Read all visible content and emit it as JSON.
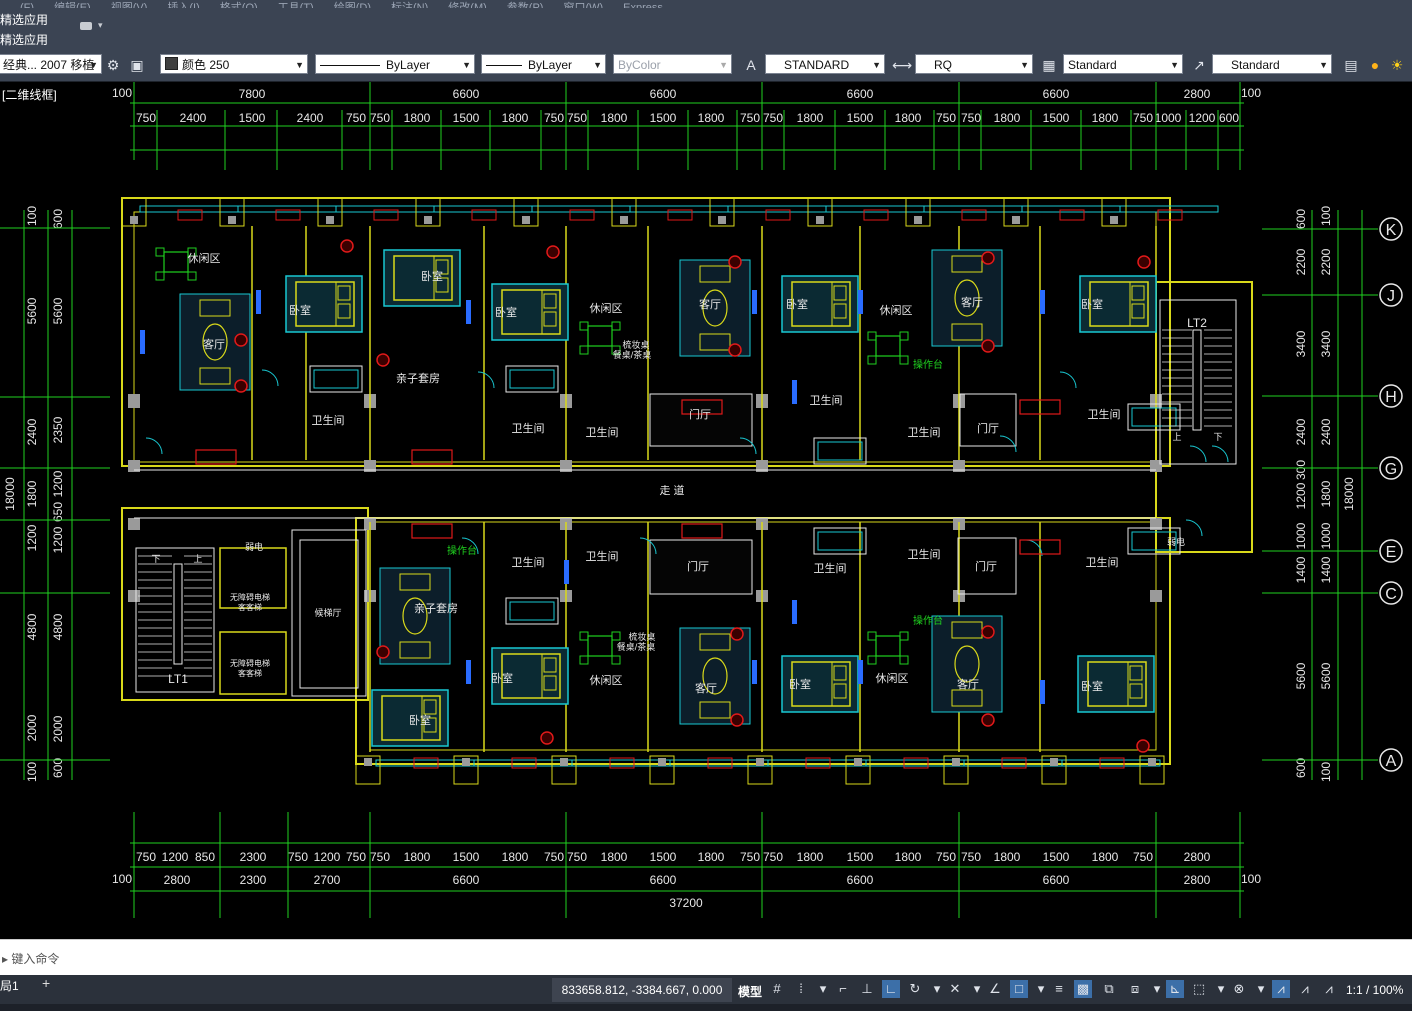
{
  "menubar": {
    "items": [
      "(F)",
      "编辑(E)",
      "视图(V)",
      "插入(I)",
      "格式(O)",
      "工具(T)",
      "绘图(D)",
      "标注(N)",
      "修改(M)",
      "参数(P)",
      "窗口(W)",
      "Express"
    ]
  },
  "ribbon": {
    "tab_label": "精选应用",
    "panel_label": "精选应用"
  },
  "propbar": {
    "workspace": "经典... 2007 移植",
    "color": "颜色 250",
    "linetype": "ByLayer",
    "lineweight": "ByLayer",
    "plotstyle": "ByColor",
    "textstyle": "STANDARD",
    "dimstyle": "RQ",
    "tablestyle": "Standard",
    "mleaderstyle": "Standard"
  },
  "viewport": {
    "label": "[二维线框]"
  },
  "drawing": {
    "top_totals": [
      "7800",
      "6600",
      "6600",
      "6600",
      "6600",
      "2800"
    ],
    "top_subdims": [
      "750",
      "2400",
      "1500",
      "2400",
      "750",
      "750",
      "1800",
      "1500",
      "1800",
      "750",
      "750",
      "1800",
      "1500",
      "1800",
      "750",
      "750",
      "1800",
      "1500",
      "1800",
      "750",
      "750",
      "1800",
      "1500",
      "1800",
      "750",
      "1000",
      "1200",
      "600"
    ],
    "edge_100": "100",
    "bottom_subdims": [
      "750",
      "1200",
      "850",
      "2300",
      "750",
      "1200",
      "750",
      "750",
      "1800",
      "1500",
      "1800",
      "750",
      "750",
      "1800",
      "1500",
      "1800",
      "750",
      "750",
      "1800",
      "1500",
      "1800",
      "750",
      "750",
      "1800",
      "1500",
      "1800",
      "750",
      "2800"
    ],
    "bottom_totals": [
      "2800",
      "2300",
      "2700",
      "6600",
      "6600",
      "6600",
      "6600",
      "2800"
    ],
    "overall": "37200",
    "left_dims_outer": [
      "100",
      "5600",
      "2400",
      "1800",
      "1200",
      "4800",
      "2000",
      "100"
    ],
    "left_dims_inner": [
      "600",
      "5600",
      "2350",
      "1200",
      "650",
      "1200",
      "4800",
      "2000",
      "600"
    ],
    "left_total": "18000",
    "right_dims_inner": [
      "600",
      "2200",
      "3400",
      "2400",
      "300",
      "1200",
      "1000",
      "1400",
      "5600",
      "600"
    ],
    "right_dims_outer": [
      "100",
      "2200",
      "3400",
      "2400",
      "1800",
      "1000",
      "1400",
      "5600",
      "100"
    ],
    "right_total": "18000",
    "axis_labels": [
      "K",
      "J",
      "H",
      "G",
      "E",
      "C",
      "A"
    ],
    "rooms": {
      "leisure": "休闲区",
      "living": "客厅",
      "bedroom": "卧室",
      "bath": "卫生间",
      "family": "亲子套房",
      "lobby": "门厅",
      "corridor": "走 道",
      "stair1": "LT1",
      "stair2": "LT2",
      "op": "操作台",
      "tea": "梳妆桌",
      "tea2": "餐桌/茶桌",
      "elec": "弱电",
      "lift1": "无障碍电梯",
      "lift2": "客客梯",
      "lift_hall": "候梯厅",
      "down": "下",
      "up": "上"
    }
  },
  "command": {
    "placeholder": "键入命令"
  },
  "status": {
    "layout": "局1",
    "coord": "833658.812, -3384.667, 0.000",
    "model": "模型",
    "scale": "1:1 / 100%"
  },
  "colors": {
    "yellow": "#d9d91a",
    "green": "#1fd11f",
    "cyan": "#19c8d2",
    "red": "#e01919",
    "white": "#e8e8e8",
    "blue": "#2a6cff",
    "grey": "#9a9a9a"
  }
}
